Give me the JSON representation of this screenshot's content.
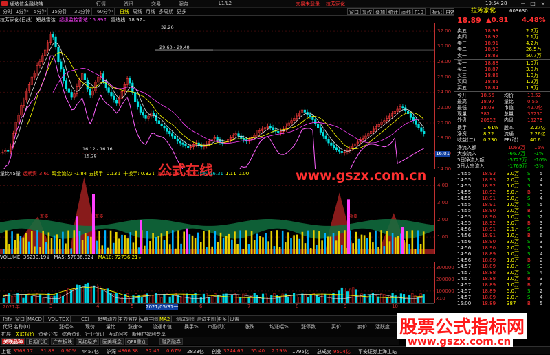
{
  "window": {
    "app_title": "通达信金融终端",
    "menu": [
      "行情",
      "资讯",
      "交易",
      "服务"
    ],
    "trade_login": "交易未登录",
    "stock_name_red": "拉芳家化",
    "min": "－",
    "max": "□",
    "close": "×"
  },
  "toolbar": {
    "periods": [
      "分时",
      "1分钟",
      "5分钟",
      "15分钟",
      "30分钟",
      "60分钟",
      "日线",
      "周线",
      "月线",
      "多周期",
      "更多"
    ],
    "active_period": "日线",
    "right_buttons": [
      "窗口",
      "复权",
      "叠加",
      "统计",
      "画线",
      "F10",
      "标记",
      "自选",
      "返回"
    ],
    "x_btn": "×"
  },
  "chart_header": {
    "stock": "拉芳家化(日线)",
    "ind1": "短线雷达",
    "ind1_val": "超级监控雷达 15.89↑",
    "ind2": "雷达线: 18.97↓"
  },
  "kline": {
    "annotations": [
      "32.26",
      "29.60 - 29.40",
      "16.12 - 16.16",
      "15.28",
      "16.01"
    ],
    "y_axis": [
      "32.00",
      "30.00",
      "28.00",
      "26.00",
      "24.00",
      "22.00",
      "20.00",
      "18.00",
      "16.00",
      "14.00"
    ],
    "price_tag": "16.01"
  },
  "indicator": {
    "header": [
      "量比45量",
      "远期资",
      "3.60",
      "现金流亿: -1.84",
      "五换手: 0.13↓",
      "十换手: 0.32↓",
      "加力",
      "16.64",
      "0.00",
      "中线",
      "16.31",
      "1.11",
      "0.00"
    ],
    "y_axis": [
      "4.00",
      "3.00",
      "2.00",
      "1.00"
    ],
    "labels": [
      "涨停",
      "涨停",
      "涨停"
    ]
  },
  "volume": {
    "header": [
      "VOLUME: 36230.19↓",
      "MA5: 57836.02↓",
      "MA10: 72736.21↓"
    ],
    "y_axis": [
      "300000",
      "200000",
      "100000",
      "X10"
    ],
    "dates": [
      "2021年",
      "3",
      "4",
      "5",
      "2021/05/31一",
      "6",
      "7",
      "8",
      "9",
      "10"
    ]
  },
  "tabs": [
    "指标",
    "窗口",
    "MACD",
    "VOL-TDX",
    "CCI",
    "趋势动力",
    "主力监控",
    "私募主图",
    "MA2",
    "测试副图",
    "测试主图",
    "更多",
    "设置"
  ],
  "tabs_selected": "MA2",
  "columns": [
    "代码",
    "名称(0)",
    "涨幅%",
    "现价",
    "量比",
    "涨速%",
    "流通市值",
    "换手%",
    "市盈(动)",
    "涨跌",
    "均涨幅%",
    "涨停数",
    "买价",
    "卖价",
    "活跃度"
  ],
  "bottom_tabs": [
    "关联品种",
    "日期代汇",
    "广东板块",
    "网红经济",
    "医美概念",
    "QFII重仓",
    "融资融券"
  ],
  "bottom_row2": [
    "扩展",
    "关联报价",
    "资金分布",
    "综合资讯",
    "行业资讯",
    "互动问答",
    "新用户福利专享"
  ],
  "status": [
    {
      "label": "上证",
      "vals": [
        "3568.17",
        "31.88",
        "0.90%",
        "4457亿"
      ]
    },
    {
      "label": "沪深",
      "vals": [
        "4866.38",
        "32.45",
        "0.67%",
        "2833亿"
      ]
    },
    {
      "label": "创业",
      "vals": [
        "3244.65",
        "55.40",
        "2.19%",
        "1795亿"
      ]
    },
    {
      "label": "总成交",
      "vals": [
        "9504亿"
      ]
    },
    {
      "label": "平安证券上海主站",
      "vals": []
    }
  ],
  "time": "19:54:28",
  "side": {
    "name": "拉芳家化",
    "code": "603630",
    "price": "18.89",
    "change": "▲0.81",
    "pct": "4.48%",
    "asks": [
      {
        "l": "卖五",
        "p": "18.93",
        "v": "2.7万"
      },
      {
        "l": "卖四",
        "p": "18.92",
        "v": "2.1万"
      },
      {
        "l": "卖三",
        "p": "18.91",
        "v": "4.2万"
      },
      {
        "l": "卖二",
        "p": "18.90",
        "v": "26.5万"
      },
      {
        "l": "卖一",
        "p": "18.89",
        "v": "50.7万"
      }
    ],
    "bids": [
      {
        "l": "买一",
        "p": "18.88",
        "v": "1.0万"
      },
      {
        "l": "买二",
        "p": "18.87",
        "v": "3.0万"
      },
      {
        "l": "买三",
        "p": "18.86",
        "v": "1.0万"
      },
      {
        "l": "买四",
        "p": "18.85",
        "v": "1.2万"
      },
      {
        "l": "买五",
        "p": "18.84",
        "v": "1.3万"
      }
    ],
    "stats": [
      {
        "l1": "今开",
        "v1": "18.55",
        "l2": "均价",
        "v2": "18.52"
      },
      {
        "l1": "最高",
        "v1": "18.97",
        "l2": "量比",
        "v2": "0.55"
      },
      {
        "l1": "最低",
        "v1": "18.08",
        "l2": "市值",
        "v2": "42.0亿"
      },
      {
        "l1": "现量",
        "v1": "387",
        "l2": "总量",
        "v2": "36230"
      },
      {
        "l1": "外盘",
        "v1": "20952",
        "l2": "内盘",
        "v2": "15278"
      }
    ],
    "stats2": [
      {
        "l1": "换手",
        "v1": "1.61%",
        "l2": "股本",
        "v2": "2.27亿"
      },
      {
        "l1": "净资",
        "v1": "8.22",
        "l2": "流通",
        "v2": "2.26亿"
      },
      {
        "l1": "收益(二)",
        "v1": "0.230",
        "l2": "PE(动)",
        "v2": "40.6"
      }
    ],
    "flows": [
      {
        "l": "净流入额",
        "v": "1069万",
        "p": "16%"
      },
      {
        "l": "大宗流入",
        "v": "-66.7万",
        "p": "-1%"
      },
      {
        "l": "5日净流入额",
        "v": "-5722万",
        "p": "-10%"
      },
      {
        "l": "5日大宗流入",
        "v": "-1769万",
        "p": "-3%"
      }
    ],
    "ticks": [
      {
        "t": "14:55",
        "p": "18.93",
        "v": "3.0万",
        "s": "S",
        "n": "5"
      },
      {
        "t": "14:55",
        "p": "18.93",
        "v": "2.0万",
        "s": "S",
        "n": "4"
      },
      {
        "t": "14:55",
        "p": "18.92",
        "v": "1.0万",
        "s": "S",
        "n": "3"
      },
      {
        "t": "14:55",
        "p": "18.92",
        "v": "5.0万",
        "s": "B",
        "n": "3"
      },
      {
        "t": "14:55",
        "p": "18.91",
        "v": "3.0万",
        "s": "S",
        "n": "4"
      },
      {
        "t": "14:55",
        "p": "18.91",
        "v": "1.0万",
        "s": "S",
        "n": "5"
      },
      {
        "t": "14:55",
        "p": "18.90",
        "v": "2.0万",
        "s": "B",
        "n": "2"
      },
      {
        "t": "14:55",
        "p": "18.90",
        "v": "1.0万",
        "s": "S",
        "n": "2"
      },
      {
        "t": "14:55",
        "p": "18.92",
        "v": "3.0万",
        "s": "B",
        "n": "3"
      },
      {
        "t": "14:56",
        "p": "18.91",
        "v": "2.1万",
        "s": "S",
        "n": "5"
      },
      {
        "t": "14:56",
        "p": "18.91",
        "v": "1.0万",
        "s": "B",
        "n": "6"
      },
      {
        "t": "14:56",
        "p": "18.90",
        "v": "3.0万",
        "s": "S",
        "n": "3"
      },
      {
        "t": "14:56",
        "p": "18.90",
        "v": "2.0万",
        "s": "S",
        "n": "3"
      },
      {
        "t": "14:56",
        "p": "18.89",
        "v": "1.0万",
        "s": "S",
        "n": "4"
      },
      {
        "t": "14:56",
        "p": "18.89",
        "v": "1.0万",
        "s": "B",
        "n": "2"
      },
      {
        "t": "14:57",
        "p": "18.89",
        "v": "2.0万",
        "s": "S",
        "n": "3"
      },
      {
        "t": "14:57",
        "p": "18.88",
        "v": "3.0万",
        "s": "S",
        "n": "4"
      },
      {
        "t": "14:57",
        "p": "18.88",
        "v": "1.0万",
        "s": "B",
        "n": "3"
      },
      {
        "t": "14:57",
        "p": "18.89",
        "v": "1.0万",
        "s": "B",
        "n": "6"
      },
      {
        "t": "14:57",
        "p": "18.89",
        "v": "5.0万",
        "s": "S",
        "n": "2"
      },
      {
        "t": "14:57",
        "p": "18.89",
        "v": "2.0万",
        "s": "S",
        "n": "4"
      },
      {
        "t": "15:00",
        "p": "18.89",
        "v": "387",
        "s": "B",
        "n": "5"
      }
    ]
  },
  "watermarks": {
    "w1": "公式在线",
    "w2": "www.gszx.com.cn",
    "w3": "股票公式指标网",
    "w4": "www.gszx.com.cn"
  }
}
